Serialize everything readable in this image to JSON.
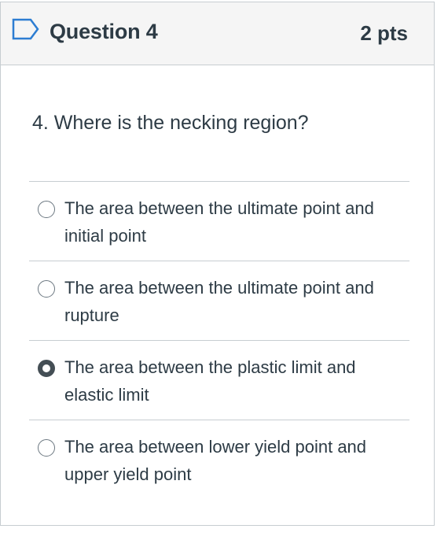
{
  "question": {
    "title": "Question 4",
    "points": "2 pts",
    "text": "4. Where is the necking region?",
    "flag_icon": "bookmark-flag-icon"
  },
  "answers": [
    {
      "label": "The area between the ultimate point and initial point",
      "selected": false
    },
    {
      "label": "The area between the ultimate point and rupture",
      "selected": false
    },
    {
      "label": "The area between the plastic limit and elastic limit",
      "selected": true
    },
    {
      "label": "The area between lower yield point and upper yield point",
      "selected": false
    }
  ],
  "colors": {
    "text": "#2d3b45",
    "header_bg": "#f5f5f5",
    "border": "#c7cdd1",
    "flag": "#2d7dd2"
  }
}
